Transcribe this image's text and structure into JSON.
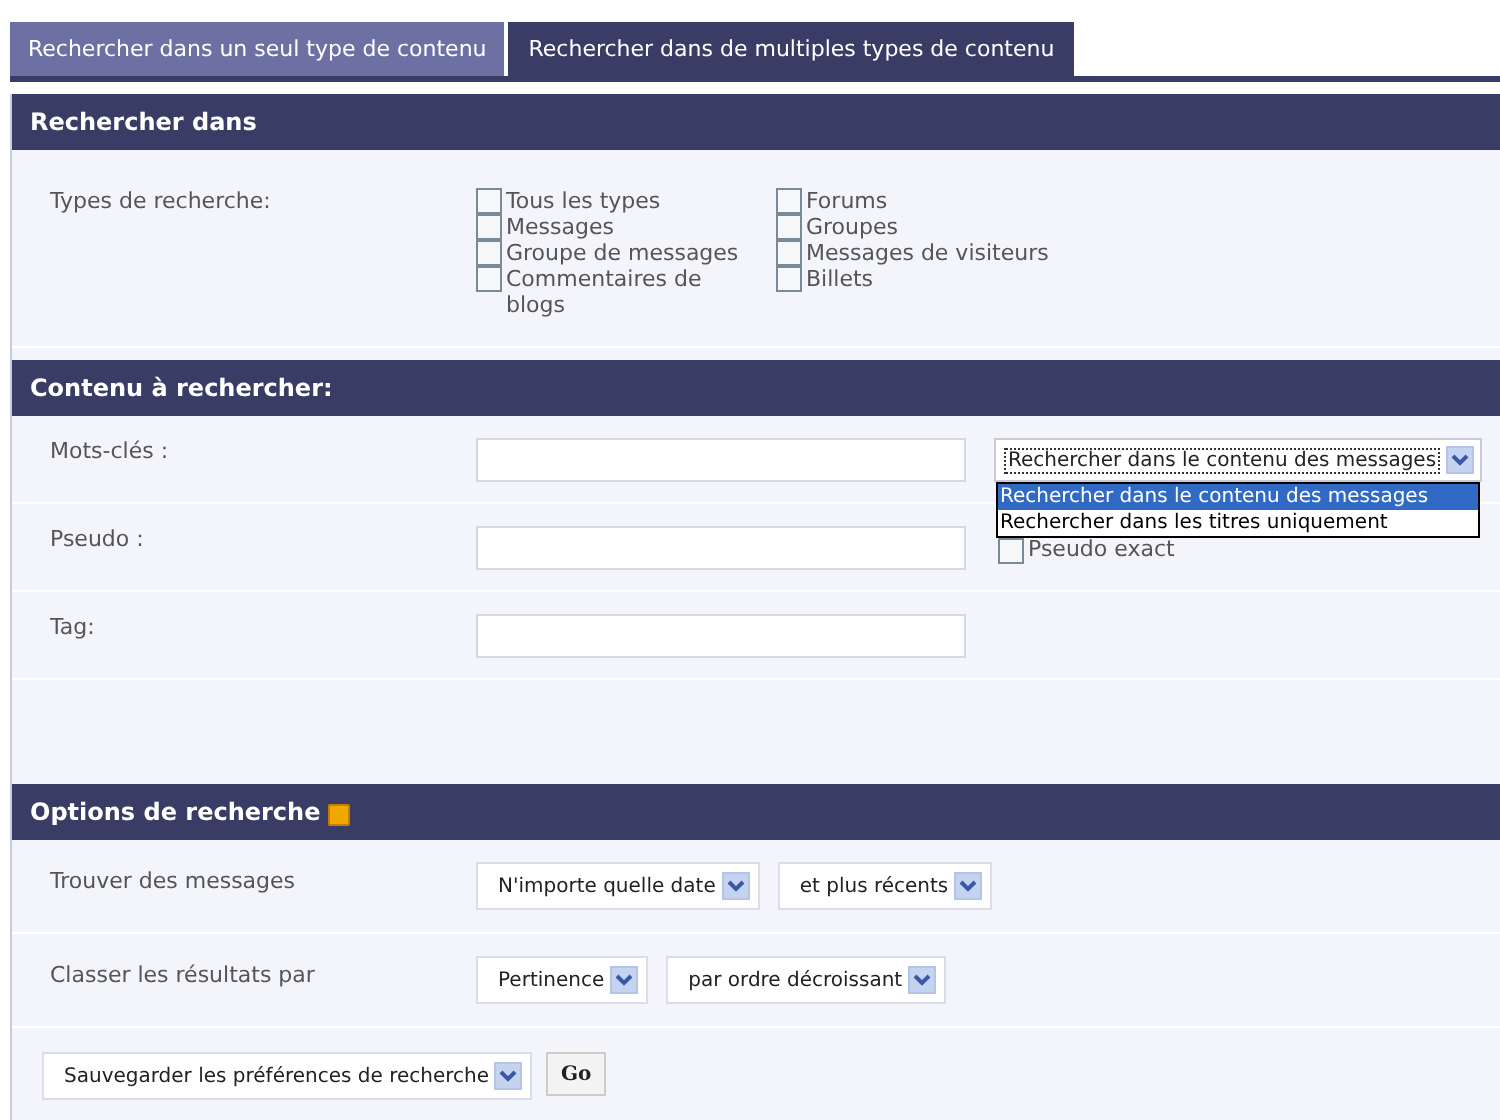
{
  "tabs": [
    {
      "label": "Rechercher dans un seul type de contenu",
      "selected": false
    },
    {
      "label": "Rechercher dans de multiples types de contenu",
      "selected": true
    }
  ],
  "sections": [
    {
      "title": "Rechercher dans",
      "collapse_icon": false,
      "rows": [
        {
          "kind": "checkboxes",
          "label": "Types de recherche:",
          "columns": [
            [
              {
                "label": "Tous les types",
                "checked": false
              },
              {
                "label": "Messages",
                "checked": false
              },
              {
                "label": "Groupe de messages",
                "checked": false
              },
              {
                "label": "Commentaires de blogs",
                "checked": false
              }
            ],
            [
              {
                "label": "Forums",
                "checked": false
              },
              {
                "label": "Groupes",
                "checked": false
              },
              {
                "label": "Messages de visiteurs",
                "checked": false
              },
              {
                "label": "Billets",
                "checked": false
              }
            ]
          ]
        }
      ]
    },
    {
      "title": "Contenu à rechercher:",
      "collapse_icon": false,
      "rows": [
        {
          "kind": "text",
          "label": "Mots-clés :",
          "select": {
            "value": "Rechercher dans le contenu des messages",
            "expanded": true,
            "options": [
              {
                "label": "Rechercher dans le contenu des messages",
                "selected": true
              },
              {
                "label": "Rechercher dans les titres uniquement",
                "selected": false
              }
            ]
          }
        },
        {
          "kind": "text",
          "label": "Pseudo :",
          "checkbox": {
            "label": "Pseudo exact",
            "checked": false
          }
        },
        {
          "kind": "text",
          "label": "Tag:"
        }
      ]
    },
    {
      "title": "Options de recherche",
      "collapse_icon": true,
      "rows": [
        {
          "kind": "selects",
          "label": "Trouver des messages",
          "selects": [
            "N'importe quelle date",
            "et plus récents"
          ]
        },
        {
          "kind": "selects",
          "label": "Classer les résultats par",
          "selects": [
            "Pertinence",
            "par ordre décroissant"
          ]
        }
      ]
    }
  ],
  "footer": {
    "select": "Sauvegarder les préférences de recherche",
    "button": "Go"
  }
}
